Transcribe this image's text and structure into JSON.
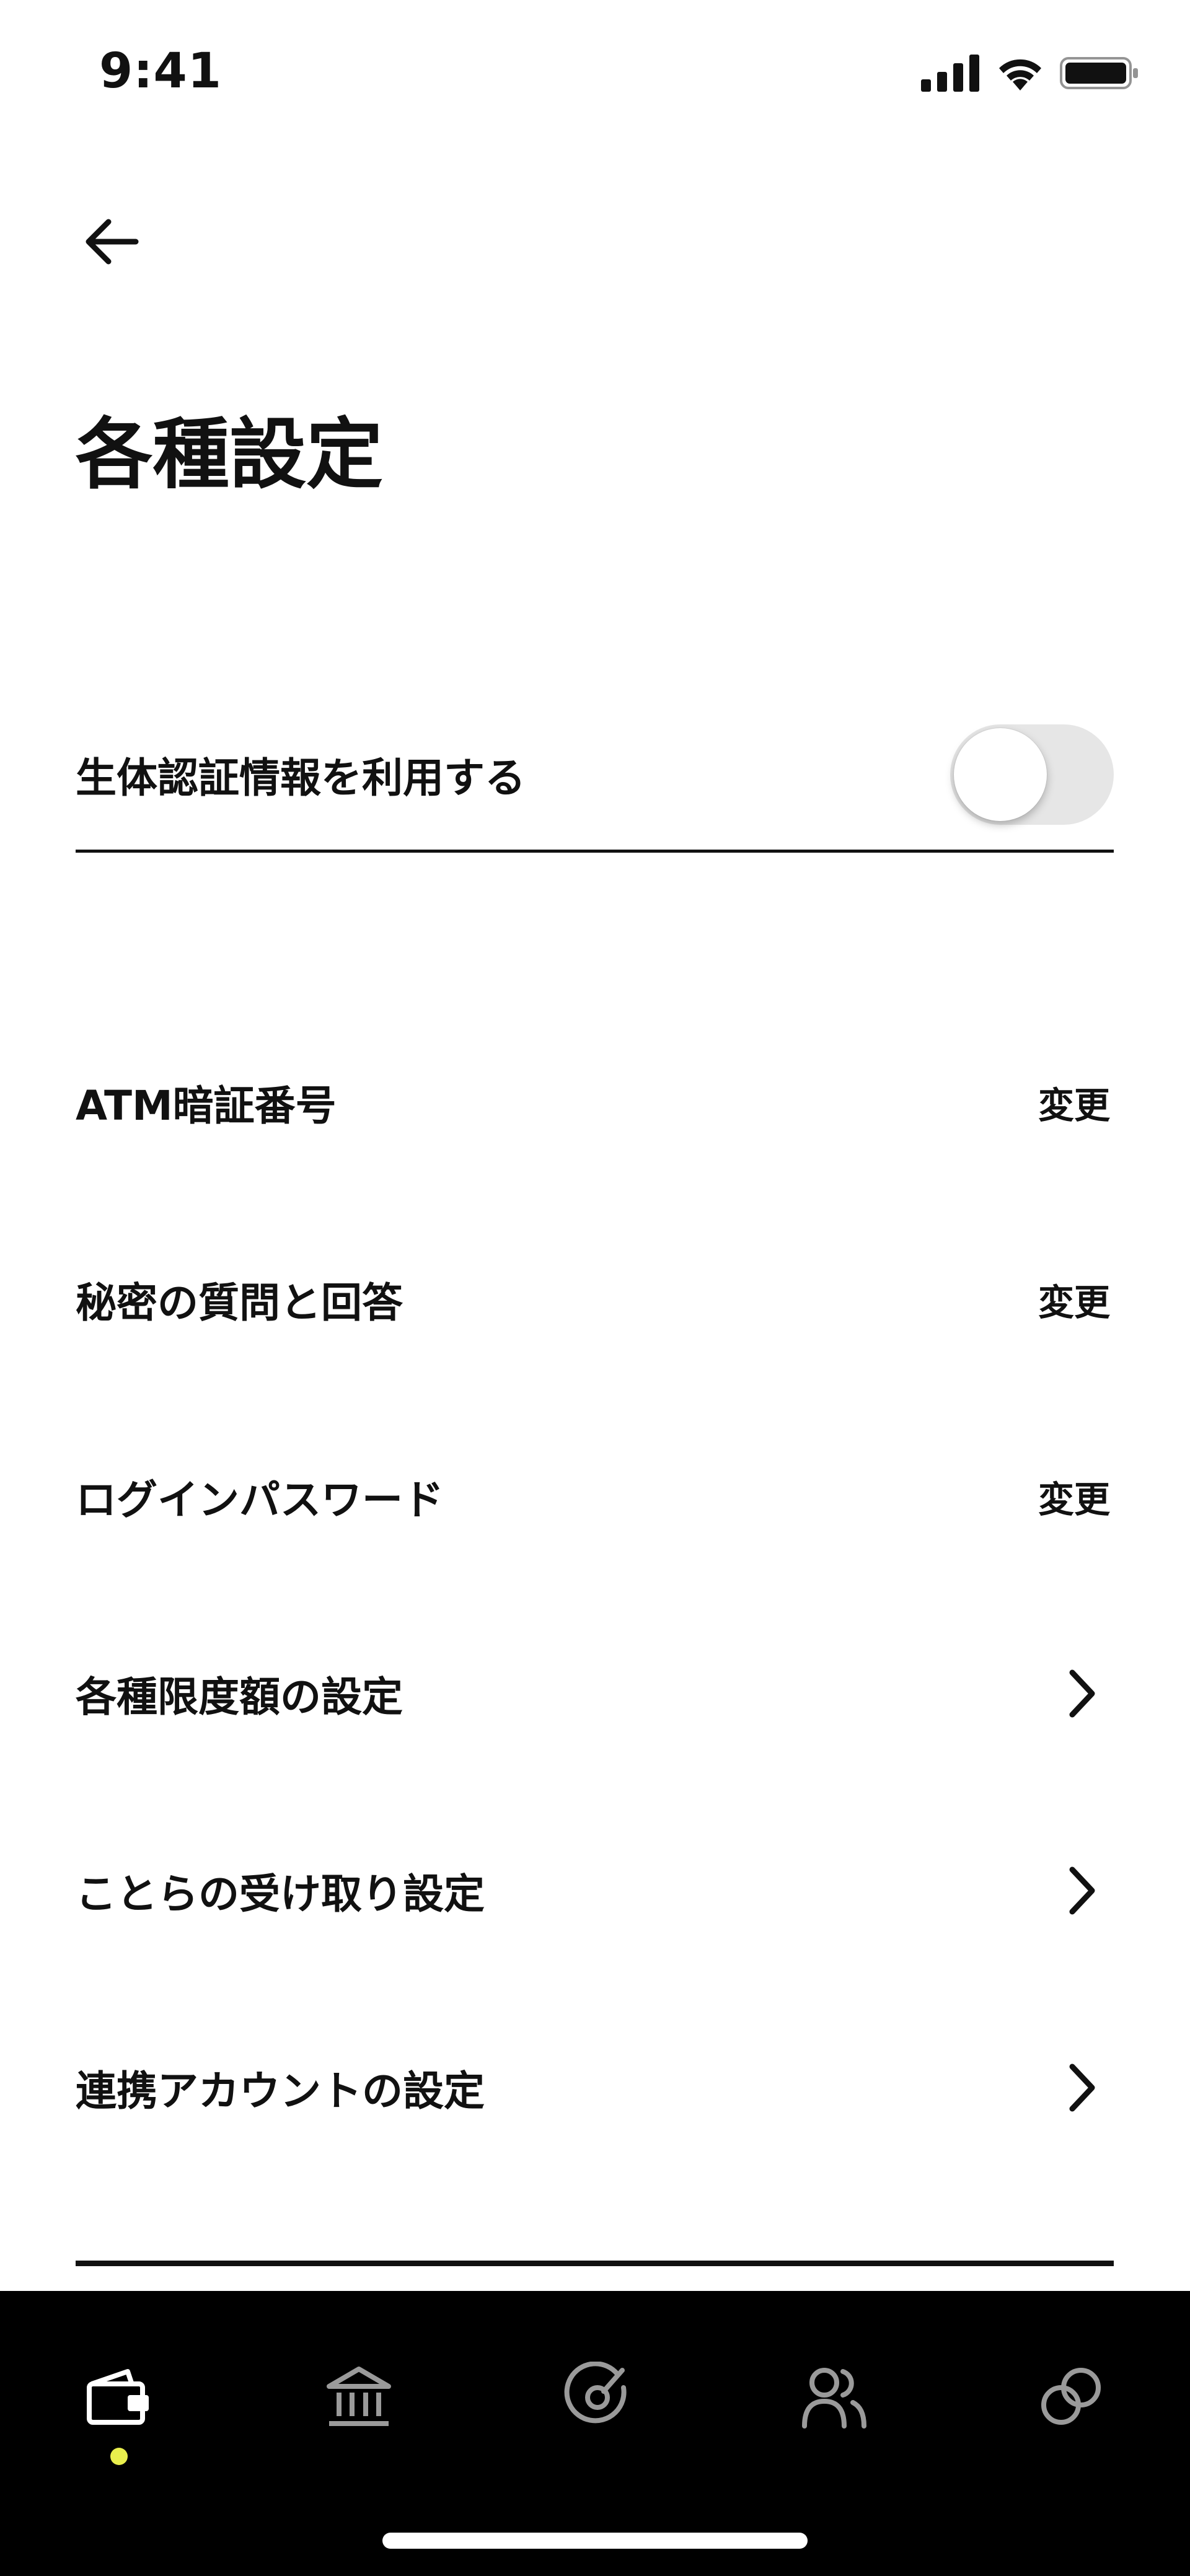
{
  "status_bar": {
    "time": "9:41"
  },
  "header": {
    "title": "各種設定"
  },
  "biometric": {
    "label": "生体認証情報を利用する",
    "enabled": false
  },
  "settings": {
    "atm_pin": {
      "label": "ATM暗証番号",
      "action": "変更"
    },
    "secret_question": {
      "label": "秘密の質問と回答",
      "action": "変更"
    },
    "login_password": {
      "label": "ログインパスワード",
      "action": "変更"
    },
    "limits": {
      "label": "各種限度額の設定"
    },
    "receive": {
      "label": "ことらの受け取り設定"
    },
    "linked_accounts": {
      "label": "連携アカウントの設定"
    }
  },
  "nav": {
    "items": [
      "wallet-icon",
      "bank-icon",
      "target-icon",
      "people-icon",
      "link-icon"
    ],
    "active": "wallet-icon",
    "active_color": "#e9ef4d",
    "inactive_color": "#9a9a9a"
  }
}
